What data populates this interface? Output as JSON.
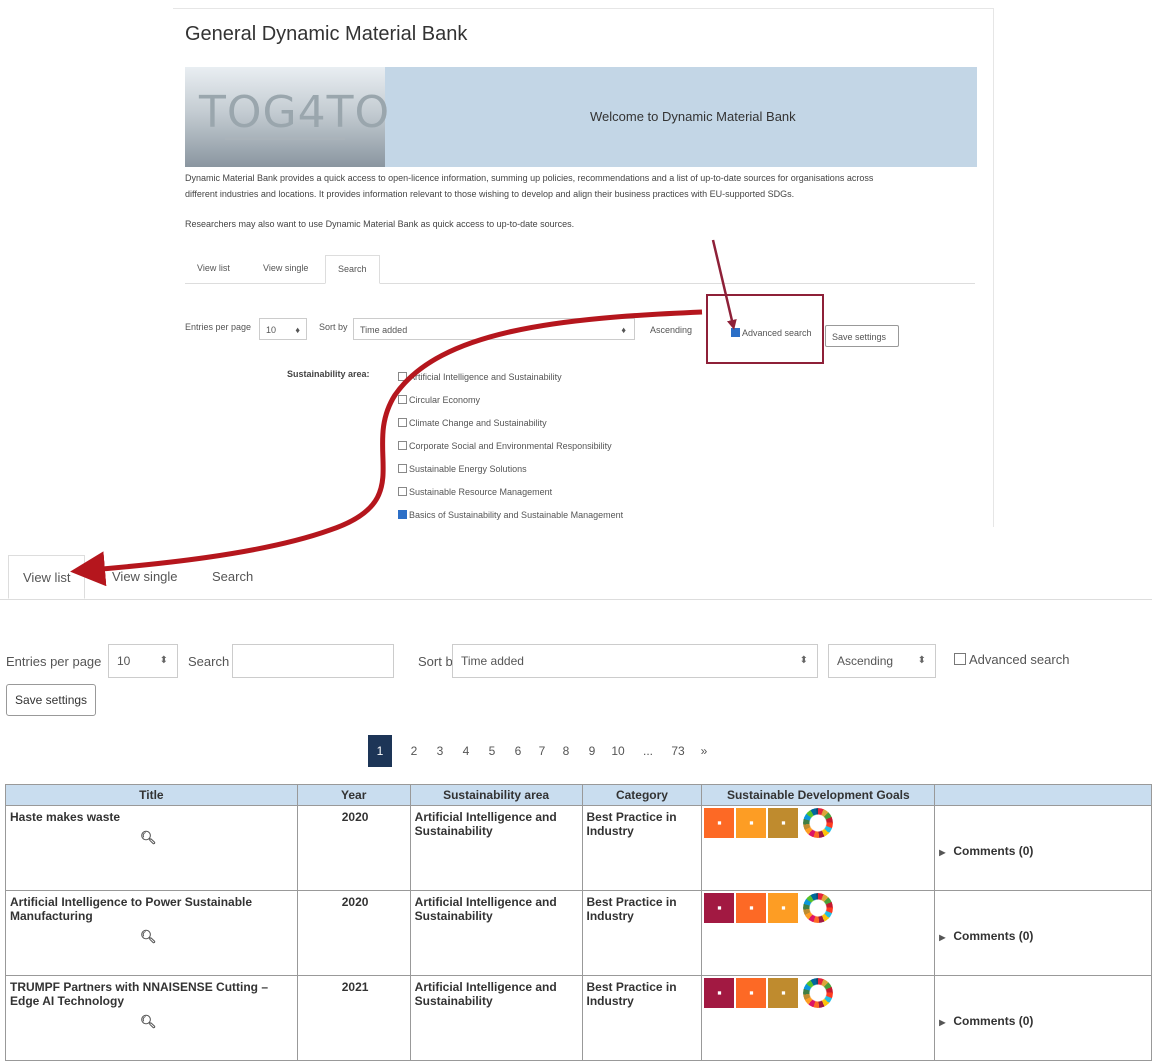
{
  "top_panel": {
    "title": "General Dynamic Material Bank",
    "logo_text": "TOG4TO",
    "welcome": "Welcome to Dynamic Material Bank",
    "description_line1": "Dynamic Material Bank provides a quick access to open-licence information, summing up policies, recommendations and a list of up-to-date sources for organisations across",
    "description_line2": "different industries and locations. It provides information relevant to those wishing to develop and align their business practices with EU-supported SDGs.",
    "researchers_note": "Researchers may also want to use Dynamic Material Bank as quick access to up-to-date sources.",
    "tabs": [
      "View list",
      "View single",
      "Search"
    ],
    "entries_label": "Entries per page",
    "entries_value": "10",
    "sort_label": "Sort by",
    "sort_value": "Time added",
    "order_value": "Ascending",
    "advanced_search": "Advanced search",
    "save_settings": "Save settings",
    "sustainability_label": "Sustainability area:",
    "areas": [
      {
        "label": "Artificial Intelligence and Sustainability",
        "checked": false
      },
      {
        "label": "Circular Economy",
        "checked": false
      },
      {
        "label": "Climate Change and Sustainability",
        "checked": false
      },
      {
        "label": "Corporate Social and Environmental Responsibility",
        "checked": false
      },
      {
        "label": "Sustainable Energy Solutions",
        "checked": false
      },
      {
        "label": "Sustainable Resource Management",
        "checked": false
      },
      {
        "label": "Basics of Sustainability and Sustainable Management",
        "checked": true
      }
    ]
  },
  "tabs": [
    "View list",
    "View single",
    "Search"
  ],
  "controls": {
    "entries_label": "Entries per page",
    "entries_value": "10",
    "search_label": "Search",
    "search_value": "",
    "sort_label": "Sort by",
    "sort_value": "Time added",
    "order_value": "Ascending",
    "advanced_search": "Advanced search",
    "save_settings": "Save settings"
  },
  "pagination": [
    "1",
    "2",
    "3",
    "4",
    "5",
    "6",
    "7",
    "8",
    "9",
    "10",
    "...",
    "73",
    "»"
  ],
  "table": {
    "headers": [
      "Title",
      "Year",
      "Sustainability area",
      "Category",
      "Sustainable Development Goals",
      ""
    ],
    "rows": [
      {
        "title": "Haste makes waste",
        "year": "2020",
        "area": "Artificial Intelligence and Sustainability",
        "category": "Best Practice in Industry",
        "sdgs": [
          "#fd6925",
          "#fd9d24",
          "#bf8b2e"
        ],
        "comments": "Comments (0)"
      },
      {
        "title": "Artificial Intelligence to Power Sustainable Manufacturing",
        "year": "2020",
        "area": "Artificial Intelligence and Sustainability",
        "category": "Best Practice in Industry",
        "sdgs": [
          "#a21942",
          "#fd6925",
          "#fd9d24"
        ],
        "comments": "Comments (0)"
      },
      {
        "title": "TRUMPF Partners with NNAISENSE Cutting – Edge AI Technology",
        "year": "2021",
        "area": "Artificial Intelligence and Sustainability",
        "category": "Best Practice in Industry",
        "sdgs": [
          "#a21942",
          "#fd6925",
          "#bf8b2e"
        ],
        "comments": "Comments (0)"
      }
    ]
  },
  "colors": {
    "accent": "#1d3557",
    "header_bg": "#c9ddef",
    "arrow": "#b5161d",
    "highlight": "#8e2038"
  },
  "icons": [
    "search-icon",
    "sdg-wheel-icon",
    "caret-right-icon",
    "sort-arrows-icon"
  ]
}
